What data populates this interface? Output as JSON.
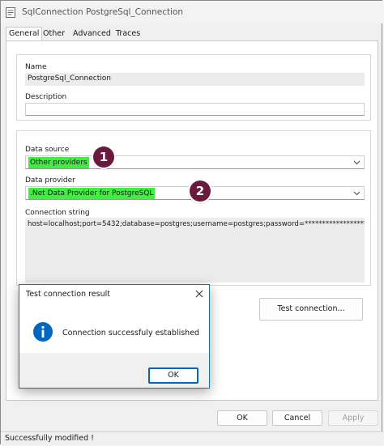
{
  "window": {
    "title": "SqlConnection PostgreSql_Connection",
    "icon": "document-icon"
  },
  "tabs": [
    {
      "label": "General",
      "active": true
    },
    {
      "label": "Other",
      "active": false
    },
    {
      "label": "Advanced",
      "active": false
    },
    {
      "label": "Traces",
      "active": false
    }
  ],
  "general": {
    "name_label": "Name",
    "name_value": "PostgreSql_Connection",
    "description_label": "Description",
    "description_value": ""
  },
  "source": {
    "data_source_label": "Data source",
    "data_source_value": "Other providers",
    "data_provider_label": "Data provider",
    "data_provider_value": ".Net Data Provider for PostgreSQL",
    "connection_string_label": "Connection string",
    "connection_string_value": "host=localhost;port=5432;database=postgres;username=postgres;password=*******************************",
    "test_connection_label": "Test connection..."
  },
  "annotations": {
    "badge_1": "1",
    "badge_2": "2",
    "highlight_color": "#3ef03e",
    "badge_color": "#6b1a3f"
  },
  "buttons": {
    "ok": "OK",
    "cancel": "Cancel",
    "apply": "Apply"
  },
  "status": {
    "text": "Successfully modified !"
  },
  "dialog": {
    "title": "Test connection result",
    "message": "Connection successfuly established",
    "ok": "OK",
    "icon": "info-icon",
    "accent_color": "#0067c0"
  }
}
